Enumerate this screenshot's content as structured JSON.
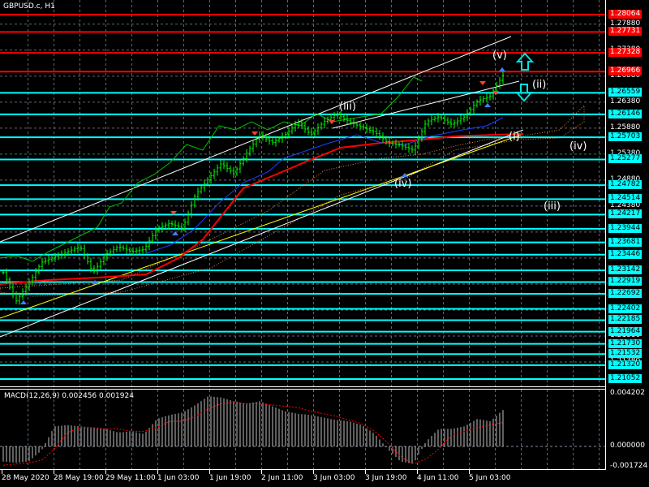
{
  "window": {
    "title": "GBPUSD.c, H1"
  },
  "chart_data": {
    "type": "bar",
    "title": "GBPUSD.c, H1",
    "price_axis": {
      "range": [
        1.21052,
        1.28064
      ],
      "grid_ticks": [
        1.2788,
        1.2738,
        1.2688,
        1.2638,
        1.2588,
        1.2538,
        1.2488,
        1.2438,
        1.2388,
        1.2338,
        1.2288,
        1.2238,
        1.2188,
        1.2138
      ]
    },
    "time_labels": [
      "28 May 2020",
      "28 May 19:00",
      "29 May 11:00",
      "1 Jun 03:00",
      "1 Jun 19:00",
      "2 Jun 11:00",
      "3 Jun 03:00",
      "3 Jun 19:00",
      "4 Jun 11:00",
      "5 Jun 03:00"
    ],
    "close_4h": [
      1.231,
      1.2255,
      1.229,
      1.233,
      1.234,
      1.235,
      1.236,
      1.231,
      1.2345,
      1.236,
      1.235,
      1.2355,
      1.2395,
      1.2405,
      1.2395,
      1.246,
      1.249,
      1.252,
      1.25,
      1.254,
      1.2575,
      1.256,
      1.2575,
      1.26,
      1.2575,
      1.26,
      1.2615,
      1.26,
      1.259,
      1.258,
      1.256,
      1.2555,
      1.2545,
      1.26,
      1.261,
      1.2595,
      1.261,
      1.264,
      1.265,
      1.269
    ],
    "levels": [
      {
        "price": "1.28064",
        "color": "#ff0000"
      },
      {
        "price": "1.27731",
        "color": "#ff0000"
      },
      {
        "price": "1.27328",
        "color": "#ff0000"
      },
      {
        "price": "1.26966",
        "color": "#ff0000"
      },
      {
        "price": "1.26559",
        "color": "#00ffff"
      },
      {
        "price": "1.26146",
        "color": "#00ffff"
      },
      {
        "price": "1.25703",
        "color": "#00ffff"
      },
      {
        "price": "1.25277",
        "color": "#00ffff"
      },
      {
        "price": "1.24782",
        "color": "#00ffff"
      },
      {
        "price": "1.24514",
        "color": "#00ffff"
      },
      {
        "price": "1.24217",
        "color": "#00ffff"
      },
      {
        "price": "1.23944",
        "color": "#00ffff"
      },
      {
        "price": "1.23681",
        "color": "#00ffff"
      },
      {
        "price": "1.23446",
        "color": "#00ffff"
      },
      {
        "price": "1.23142",
        "color": "#00ffff"
      },
      {
        "price": "1.22919",
        "color": "#00ffff"
      },
      {
        "price": "1.22692",
        "color": "#00ffff"
      },
      {
        "price": "1.22402",
        "color": "#00ffff"
      },
      {
        "price": "1.22185",
        "color": "#00ffff"
      },
      {
        "price": "1.21964",
        "color": "#00ffff"
      },
      {
        "price": "1.21730",
        "color": "#00ffff"
      },
      {
        "price": "1.21532",
        "color": "#00ffff"
      },
      {
        "price": "1.21320",
        "color": "#00ffff"
      },
      {
        "price": "1.21052",
        "color": "#00ffff"
      }
    ],
    "wave_labels": [
      "(iii)",
      "(iv)",
      "(v)",
      "(ii)",
      "(i)",
      "(iv)",
      "(iii)"
    ],
    "macd": {
      "title": "MACD(12,26,9) 0.002456 0.001924",
      "range": [
        -0.001724,
        0.004202
      ],
      "tick_labels": [
        "0.004202",
        "0.000000",
        "-0.001724"
      ],
      "histogram_4h": [
        -0.0012,
        -0.0013,
        -0.0012,
        -0.0003,
        0.0016,
        0.0017,
        0.0016,
        0.0015,
        0.0014,
        0.0011,
        0.0012,
        0.001,
        0.0022,
        0.0025,
        0.0027,
        0.0033,
        0.004,
        0.0039,
        0.0036,
        0.0034,
        0.0036,
        0.0032,
        0.0028,
        0.0026,
        0.0025,
        0.0023,
        0.0021,
        0.002,
        0.0017,
        0.001,
        -0.0002,
        -0.0012,
        -0.0014,
        0.0004,
        0.0014,
        0.0014,
        0.0016,
        0.0022,
        0.002,
        0.0029
      ],
      "signal_4h": [
        -0.0015,
        -0.0014,
        -0.0013,
        -0.0011,
        -0.0002,
        0.0011,
        0.0015,
        0.0015,
        0.0014,
        0.0014,
        0.0012,
        0.0012,
        0.0015,
        0.002,
        0.002,
        0.0024,
        0.003,
        0.0034,
        0.0035,
        0.0034,
        0.0034,
        0.0033,
        0.0032,
        0.0031,
        0.0028,
        0.0026,
        0.0024,
        0.0021,
        0.0018,
        0.0012,
        0.0003,
        -0.0008,
        -0.0014,
        -0.001,
        -0.0002,
        0.0009,
        0.0012,
        0.0015,
        0.0017,
        0.0019
      ]
    }
  }
}
